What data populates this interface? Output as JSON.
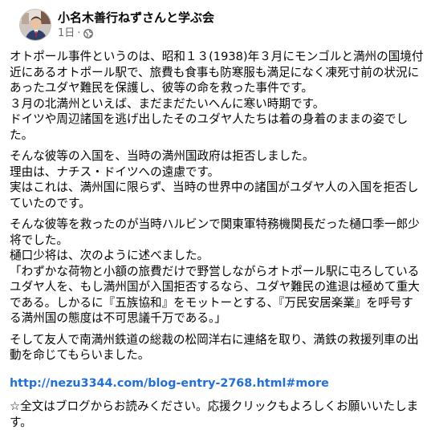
{
  "header": {
    "page_name": "小名木善行ねずさんと学ぶ会",
    "timestamp": "1日",
    "separator": "·",
    "audience_icon": "globe-icon"
  },
  "paragraphs": [
    {
      "lines": [
        "オトポール事件というのは、昭和１３(1938)年３月にモンゴルと満州の国境付",
        "近にあるオトポール駅で、旅費も食事も防寒服も満足になく凍死寸前の状況に",
        "あったユダヤ難民を保護し、彼等の命を救った事件です。",
        "３月の北満州といえば、まだまだたいへんに寒い時期です。",
        "ドイツや周辺諸国を逃げ出したそのユダヤ人たちは着の身着のままの姿でし",
        "た。"
      ]
    },
    {
      "lines": [
        "そんな彼等の入国を、当時の満州国政府は拒否しました。",
        "理由は、ナチス・ドイツへの遠慮です。",
        "実はこれは、満州国に限らず、当時の世界中の諸国がユダヤ人の入国を拒否し",
        "ていたのです。"
      ]
    },
    {
      "lines": [
        "そんな彼等を救ったのが当時ハルビンで関東軍特務機関長だった樋口季一郎少",
        "将でした。",
        "樋口少将は、次のように述べました。",
        "「わずかな荷物と小額の旅費だけで野営しながらオトポール駅に屯ろしている",
        "ユダヤ人を、もし満州国が入国拒否するなら、ユダヤ難民の進退は極めて重大",
        "である。しかるに『五族協和』をモットーとする、『万民安居楽業』を呼号す",
        "る満州国の態度は不可思議千万である。」"
      ]
    },
    {
      "lines": [
        "そして友人で南満州鉄道の総裁の松岡洋右に連絡を取り、満鉄の救援列車の出",
        "動を命じてもらいました。"
      ]
    }
  ],
  "link": {
    "text": "http://nezu3344.com/blog-entry-2768.html#more"
  },
  "closing": {
    "lines": [
      "☆全文はブログからお読みください。応援クリックもよろしくお願いいたしま",
      "す。"
    ]
  },
  "colors": {
    "link": "#216fdb",
    "meta": "#65676b",
    "text": "#050505"
  }
}
